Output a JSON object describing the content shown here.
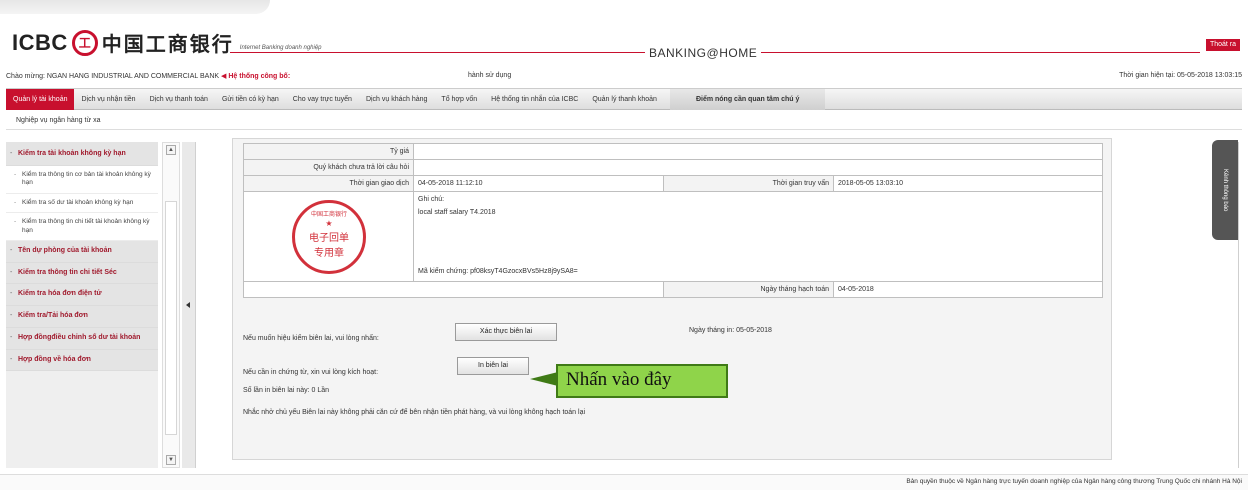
{
  "header": {
    "logo_text": "ICBC",
    "logo_mark": "工",
    "logo_chinese": "中国工商银行",
    "logo_subtitle": "Internet Banking doanh nghiệp",
    "banking_title": "BANKING@HOME",
    "logout_label": "Thoát ra",
    "greeting": "Chào mừng: NGAN HANG INDUSTRIAL AND COMMERCIAL BANK",
    "system_notice": "Hệ thống công bố:",
    "notice_mid": "hành sử dụng",
    "current_time": "Thời gian hiện tại: 05-05-2018 13:03:15",
    "brand_color": "#c8102e"
  },
  "nav": {
    "items": [
      "Quản lý tài khoản",
      "Dịch vụ nhận tiền",
      "Dịch vụ thanh toán",
      "Gửi tiền có kỳ hạn",
      "Cho vay trực tuyến",
      "Dịch vụ khách hàng",
      "Tổ hợp vốn",
      "Hệ thống tin nhắn của ICBC",
      "Quản lý thanh khoản"
    ],
    "highlight": "Điểm nóng cần quan tâm chú ý",
    "sub": "Nghiệp vụ ngân hàng từ xa"
  },
  "sidebar": {
    "section1": "Kiểm tra tài khoản không kỳ hạn",
    "sub1": "Kiểm tra thông tin cơ bản tài khoản không kỳ hạn",
    "sub2": "Kiểm tra số dư tài khoản không kỳ hạn",
    "sub3": "Kiểm tra thông tin chi tiết tài khoản không kỳ hạn",
    "section2": "Tên dự phòng của tài khoản",
    "section3": "Kiểm tra thông tin chi tiết Séc",
    "section4": "Kiểm tra hóa đơn điện tử",
    "section5": "Kiểm tra/Tải hóa đơn",
    "section6": "Hợp đồngđiều chỉnh số dư tài khoản",
    "section7": "Hợp đồng về hóa đơn"
  },
  "receipt": {
    "rate_label": "Tỷ giá",
    "reply_label": "Quý khách chưa trả lời câu hỏi",
    "trans_time_label": "Thời gian giao dịch",
    "trans_time": "04-05-2018 11:12:10",
    "query_time_label": "Thời gian truy vấn",
    "query_time": "2018-05-05 13:03:10",
    "note_label": "Ghi chú:",
    "note_text": "local staff salary T4.2018",
    "verify_code": "Mã kiểm chứng: pf08ksyT4GzocxBVs5Hz8j9ySA8=",
    "account_date_label": "Ngày tháng hạch toán",
    "account_date": "04-05-2018",
    "stamp_arc": "中国工商银行",
    "stamp_line1": "电子回单",
    "stamp_line2": "专用章"
  },
  "actions": {
    "verify_prompt": "Nếu muốn hiệu kiểm biên lai, vui lòng nhấn:",
    "verify_button": "Xác thực biên lai",
    "print_date": "Ngày tháng in: 05-05-2018",
    "print_prompt": "Nếu cần in chứng từ, xin vui lòng kích hoạt:",
    "print_button": "In biên lai",
    "print_count": "Số lần in biên lai này: 0  Lần",
    "reminder": "Nhắc nhở chủ yếu Biên lai này không phải căn cứ để bên nhận tiền phát hàng, và vui lòng không hạch toán lại"
  },
  "callout": "Nhấn vào đây",
  "right_tab": "Kênh thông báo",
  "footer": "Bản quyền thuộc về Ngân hàng trực tuyến doanh nghiệp của Ngân hàng công thương Trung Quốc chi nhánh Hà Nội"
}
